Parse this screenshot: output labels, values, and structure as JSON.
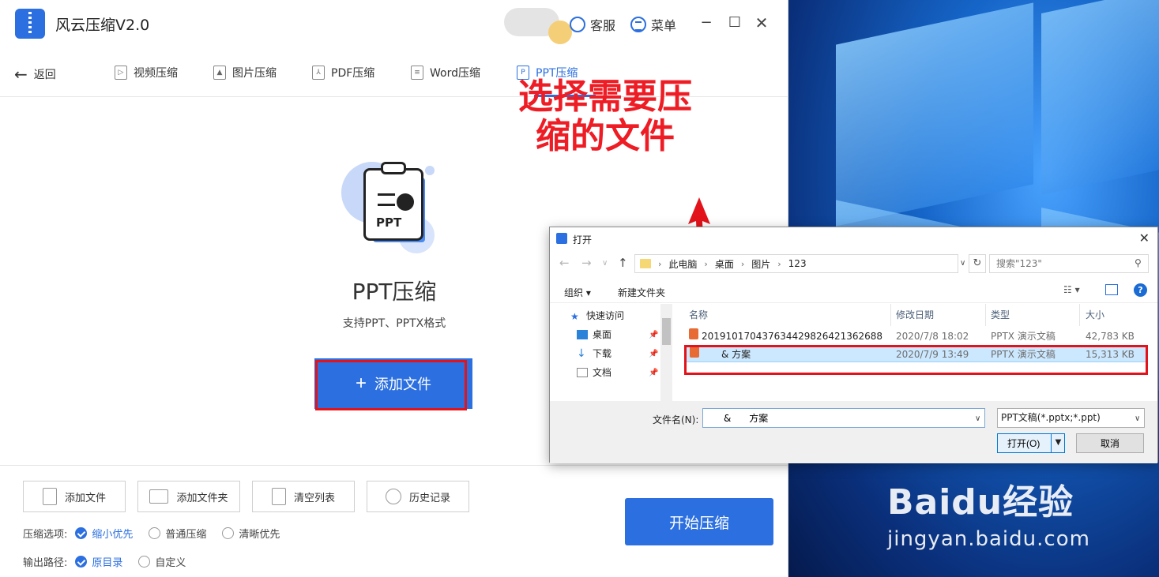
{
  "app": {
    "title": "风云压缩V2.0",
    "service_label": "客服",
    "menu_label": "菜单",
    "minimize_glyph": "−",
    "maximize_glyph": "☐",
    "close_glyph": "✕"
  },
  "nav": {
    "back_label": "返回",
    "tabs": [
      {
        "label": "视频压缩",
        "icon": "video-icon"
      },
      {
        "label": "图片压缩",
        "icon": "image-icon"
      },
      {
        "label": "PDF压缩",
        "icon": "pdf-icon"
      },
      {
        "label": "Word压缩",
        "icon": "word-icon"
      },
      {
        "label": "PPT压缩",
        "icon": "ppt-icon",
        "active": true
      }
    ]
  },
  "main": {
    "hero_badge": "PPT",
    "title": "PPT压缩",
    "subtitle": "支持PPT、PPTX格式",
    "add_file_label": "添加文件"
  },
  "bottom": {
    "buttons": [
      {
        "label": "添加文件"
      },
      {
        "label": "添加文件夹"
      },
      {
        "label": "清空列表"
      },
      {
        "label": "历史记录"
      }
    ],
    "start_label": "开始压缩",
    "compress_label": "压缩选项:",
    "compress_options": [
      "缩小优先",
      "普通压缩",
      "清晰优先"
    ],
    "compress_selected": "缩小优先",
    "output_label": "输出路径:",
    "output_options": [
      "原目录",
      "自定义"
    ],
    "output_selected": "原目录"
  },
  "annotation": {
    "line1": "选择需要压",
    "line2": "缩的文件",
    "color": "#ee1c24"
  },
  "dialog": {
    "title": "打开",
    "path": [
      "此电脑",
      "桌面",
      "图片",
      "123"
    ],
    "search_placeholder": "搜索\"123\"",
    "organize_label": "组织 ▾",
    "new_folder_label": "新建文件夹",
    "sidebar": [
      {
        "label": "快速访问",
        "icon": "star-icon"
      },
      {
        "label": "桌面",
        "icon": "desktop-icon"
      },
      {
        "label": "下载",
        "icon": "download-icon"
      },
      {
        "label": "文档",
        "icon": "document-icon"
      }
    ],
    "columns": [
      "名称",
      "修改日期",
      "类型",
      "大小"
    ],
    "files": [
      {
        "name": "20191017043763442982642136268​8",
        "date": "2020/7/8 18:02",
        "type": "PPTX 演示文稿",
        "size": "42,783 KB",
        "selected": false
      },
      {
        "name": "&      方案",
        "date": "2020/7/9 13:49",
        "type": "PPTX 演示文稿",
        "size": "15,313 KB",
        "selected": true
      }
    ],
    "filename_label": "文件名(N):",
    "filename_value": "&      方案",
    "filetype_value": "PPT文稿(*.pptx;*.ppt)",
    "open_label": "打开(O)",
    "cancel_label": "取消"
  },
  "watermark": {
    "logo": "Baidu经验",
    "url": "jingyan.baidu.com"
  },
  "colors": {
    "accent": "#2b6fe0",
    "highlight": "#e3131b"
  }
}
